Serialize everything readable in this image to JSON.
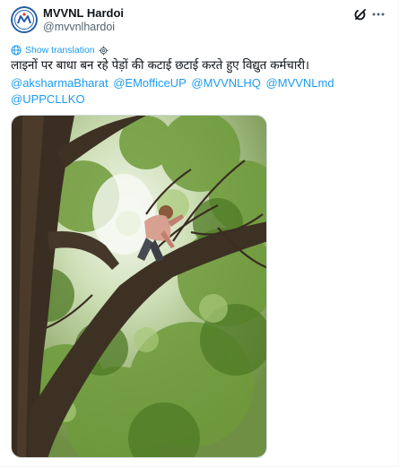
{
  "account": {
    "display_name": "MVVNL Hardoi",
    "handle": "@mvvnlhardoi"
  },
  "translation": {
    "label": "Show translation"
  },
  "tweet": {
    "text": "लाइनों पर बाधा बन रहे पेड़ों की कटाई छटाई करते हुए विद्युत कर्मचारी।",
    "mentions": [
      "@aksharmaBharat",
      "@EMofficeUP",
      "@MVVNLHQ",
      "@MVVNLmd",
      "@UPPCLLKO"
    ]
  },
  "icons": {
    "avatar": "mvvnl-logo",
    "grok": "grok-icon",
    "more": "more-icon",
    "translate": "globe-icon",
    "settings": "gear-icon"
  },
  "colors": {
    "link": "#1d9bf0",
    "text": "#0f1419",
    "secondary": "#536471",
    "logo_blue": "#1f5aa6"
  }
}
